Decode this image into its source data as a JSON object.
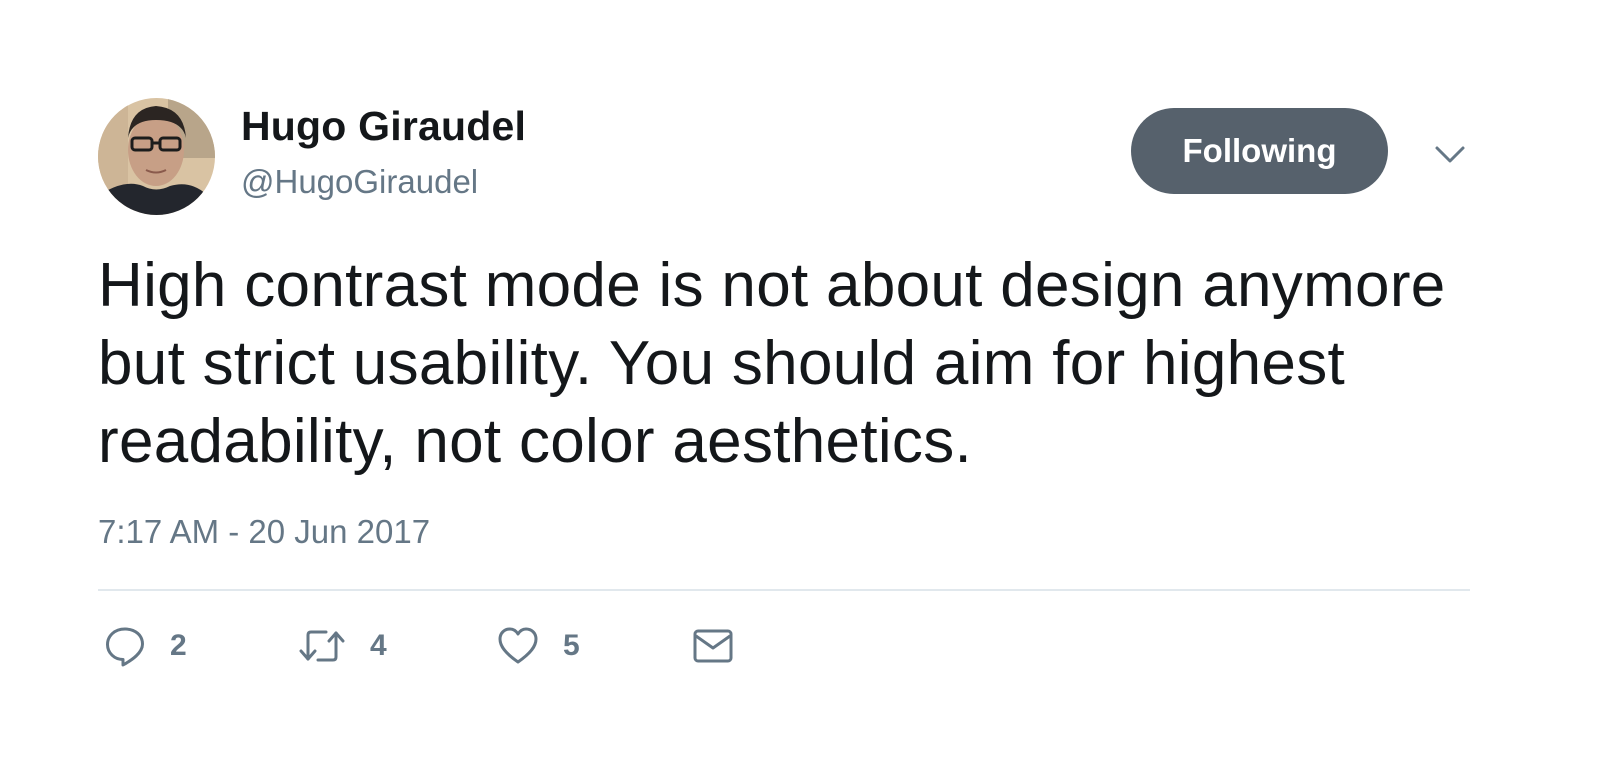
{
  "author": {
    "name": "Hugo Giraudel",
    "handle": "@HugoGiraudel",
    "avatar_icon": "user-avatar-photo"
  },
  "follow_button": {
    "label": "Following",
    "color": "#56616c"
  },
  "menu": {
    "icon": "chevron-down-icon"
  },
  "tweet": {
    "text": "High contrast mode is not about design anymore but strict usability. You should aim for highest readability, not color aesthetics.",
    "timestamp": "7:17 AM - 20 Jun 2017"
  },
  "actions": {
    "reply": {
      "icon": "reply-icon",
      "count": "2"
    },
    "retweet": {
      "icon": "retweet-icon",
      "count": "4"
    },
    "like": {
      "icon": "heart-icon",
      "count": "5"
    },
    "direct_message": {
      "icon": "envelope-icon"
    }
  },
  "colors": {
    "text_primary": "#14171a",
    "text_secondary": "#657786",
    "divider": "#e1e8ed"
  }
}
